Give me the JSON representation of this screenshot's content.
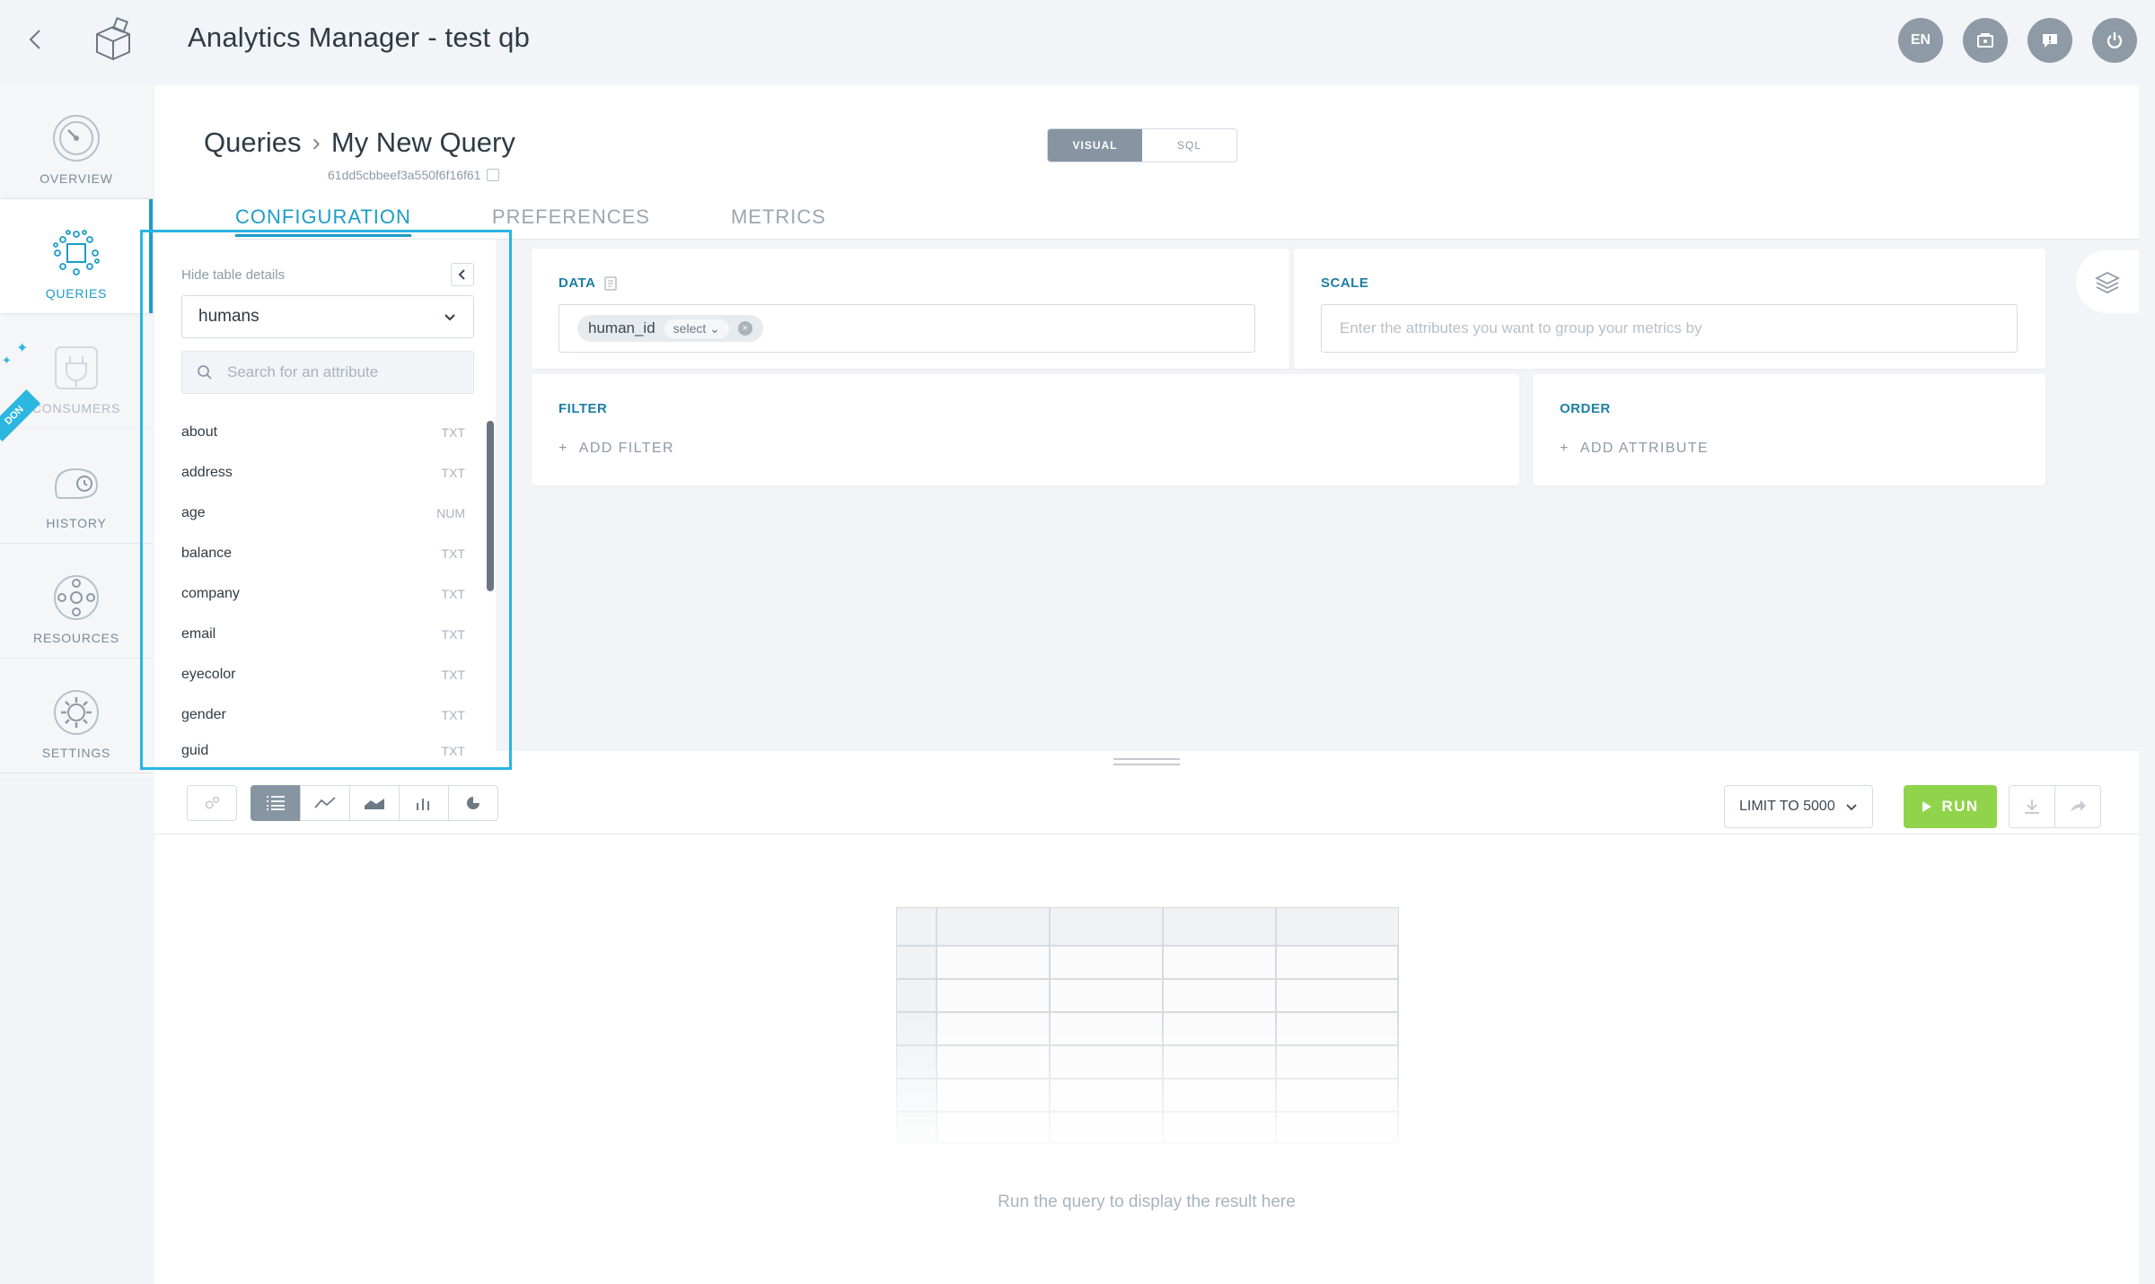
{
  "app": {
    "title": "Analytics Manager - test qb"
  },
  "topbar": {
    "lang": "EN"
  },
  "nav": {
    "items": [
      {
        "label": "OVERVIEW",
        "icon": "gauge-icon"
      },
      {
        "label": "QUERIES",
        "icon": "network-icon",
        "active": true
      },
      {
        "label": "CONSUMERS",
        "icon": "plug-icon",
        "addon": true
      },
      {
        "label": "HISTORY",
        "icon": "history-icon"
      },
      {
        "label": "RESOURCES",
        "icon": "resources-icon"
      },
      {
        "label": "SETTINGS",
        "icon": "gear-icon"
      }
    ],
    "addon_badge": "DON"
  },
  "breadcrumb": {
    "root": "Queries",
    "current": "My New Query"
  },
  "query_id": "61dd5cbbeef3a550f6f16f61",
  "mode": {
    "visual": "VISUAL",
    "sql": "SQL",
    "active": "VISUAL"
  },
  "tabs": [
    {
      "label": "CONFIGURATION",
      "active": true
    },
    {
      "label": "PREFERENCES"
    },
    {
      "label": "METRICS"
    }
  ],
  "table_panel": {
    "hide_label": "Hide table details",
    "selected_table": "humans",
    "search_placeholder": "Search for an attribute",
    "attributes": [
      {
        "name": "about",
        "type": "TXT"
      },
      {
        "name": "address",
        "type": "TXT"
      },
      {
        "name": "age",
        "type": "NUM"
      },
      {
        "name": "balance",
        "type": "TXT"
      },
      {
        "name": "company",
        "type": "TXT"
      },
      {
        "name": "email",
        "type": "TXT"
      },
      {
        "name": "eyecolor",
        "type": "TXT"
      },
      {
        "name": "gender",
        "type": "TXT"
      },
      {
        "name": "guid",
        "type": "TXT"
      }
    ]
  },
  "data_card": {
    "title": "DATA",
    "chip_label": "human_id",
    "chip_mode": "select"
  },
  "scale_card": {
    "title": "SCALE",
    "placeholder": "Enter the attributes you want to group your metrics by"
  },
  "filter_card": {
    "title": "FILTER",
    "add_label": "ADD FILTER"
  },
  "order_card": {
    "title": "ORDER",
    "add_label": "ADD ATTRIBUTE"
  },
  "toolbar": {
    "limit_label": "LIMIT TO 5000",
    "run_label": "RUN"
  },
  "result": {
    "hint": "Run the query to display the result here"
  },
  "colors": {
    "accent": "#1d9cc8",
    "run": "#8fd44a",
    "highlight": "#28b5e5"
  }
}
